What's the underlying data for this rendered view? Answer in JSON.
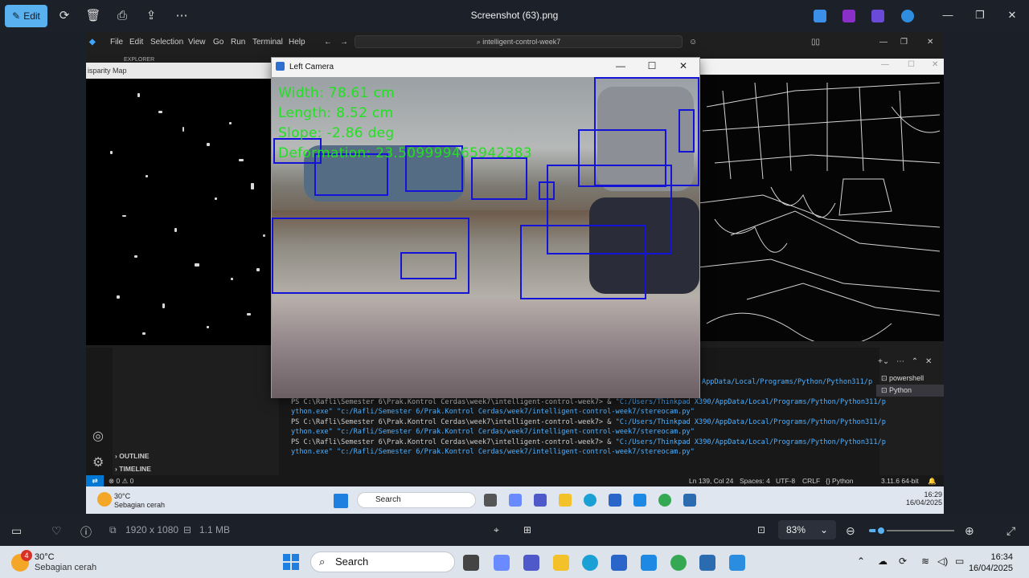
{
  "photos_app": {
    "edit_label": "Edit",
    "file_title": "Screenshot (63).png",
    "dimensions": "1920 x 1080",
    "file_size": "1.1 MB",
    "zoom": "83%",
    "zoom_level": 0.14
  },
  "vscode": {
    "menu": [
      "File",
      "Edit",
      "Selection",
      "View",
      "Go",
      "Run",
      "Terminal",
      "Help"
    ],
    "search_text": "intelligent-control-week7",
    "explorer_label": "EXPLORER",
    "outline_label": "OUTLINE",
    "timeline_label": "TIMELINE",
    "terminal_lines": [
      {
        "prompt": "PS C:\\Rafli\\Semester 6\\Prak.Kontrol Cerdas\\week7\\intelligent-control-week7> & ",
        "cmd": "\"C:/Users/Thinkpad X390/AppData/Local/Programs/Python/Python311/p"
      },
      {
        "prompt": "",
        "cmd": "ython.exe\" \"c:/Rafli/Semester 6/Prak.Kontrol Cerdas/week7/intelligent-control-week7/stereocam.py\""
      },
      {
        "prompt": "PS C:\\Rafli\\Semester 6\\Prak.Kontrol Cerdas\\week7\\intelligent-control-week7> & ",
        "cmd": "\"C:/Users/Thinkpad X390/AppData/Local/Programs/Python/Python311/p"
      },
      {
        "prompt": "",
        "cmd": "ython.exe\" \"c:/Rafli/Semester 6/Prak.Kontrol Cerdas/week7/intelligent-control-week7/stereocam.py\""
      },
      {
        "prompt": "PS C:\\Rafli\\Semester 6\\Prak.Kontrol Cerdas\\week7\\intelligent-control-week7> & ",
        "cmd": "\"C:/Users/Thinkpad X390/AppData/Local/Programs/Python/Python311/p"
      },
      {
        "prompt": "",
        "cmd": "ython.exe\" \"c:/Rafli/Semester 6/Prak.Kontrol Cerdas/week7/intelligent-control-week7/stereocam.py\""
      }
    ],
    "terminal_top_fragment": "AppData/Local/Programs/Python/Python311/p",
    "terminal_tabs": [
      "powershell",
      "Python"
    ],
    "status": {
      "errors": "0",
      "warnings": "0",
      "position": "Ln 139, Col 24",
      "spaces": "Spaces: 4",
      "encoding": "UTF-8",
      "eol": "CRLF",
      "language": "Python",
      "interpreter": "3.11.6 64-bit"
    }
  },
  "disparity_window": {
    "title": "isparity Map"
  },
  "camera_window": {
    "title": "Left Camera",
    "overlay": {
      "width": "Width: 78.61 cm",
      "length": "Length: 8.52 cm",
      "slope": "Slope: -2.86 deg",
      "deformation": "Deformation: 23.509999465942383"
    }
  },
  "inner_taskbar": {
    "temp": "30°C",
    "weather": "Sebagian cerah",
    "search": "Search",
    "time": "16:29",
    "date": "16/04/2025"
  },
  "taskbar": {
    "temp": "30°C",
    "weather": "Sebagian cerah",
    "badge": "4",
    "search": "Search",
    "time": "16:34",
    "date": "16/04/2025"
  },
  "colors": {
    "accent": "#5ab1f0",
    "overlay_text": "#22e022",
    "bbox": "#1414d8",
    "vscode_blue": "#0078d4"
  }
}
